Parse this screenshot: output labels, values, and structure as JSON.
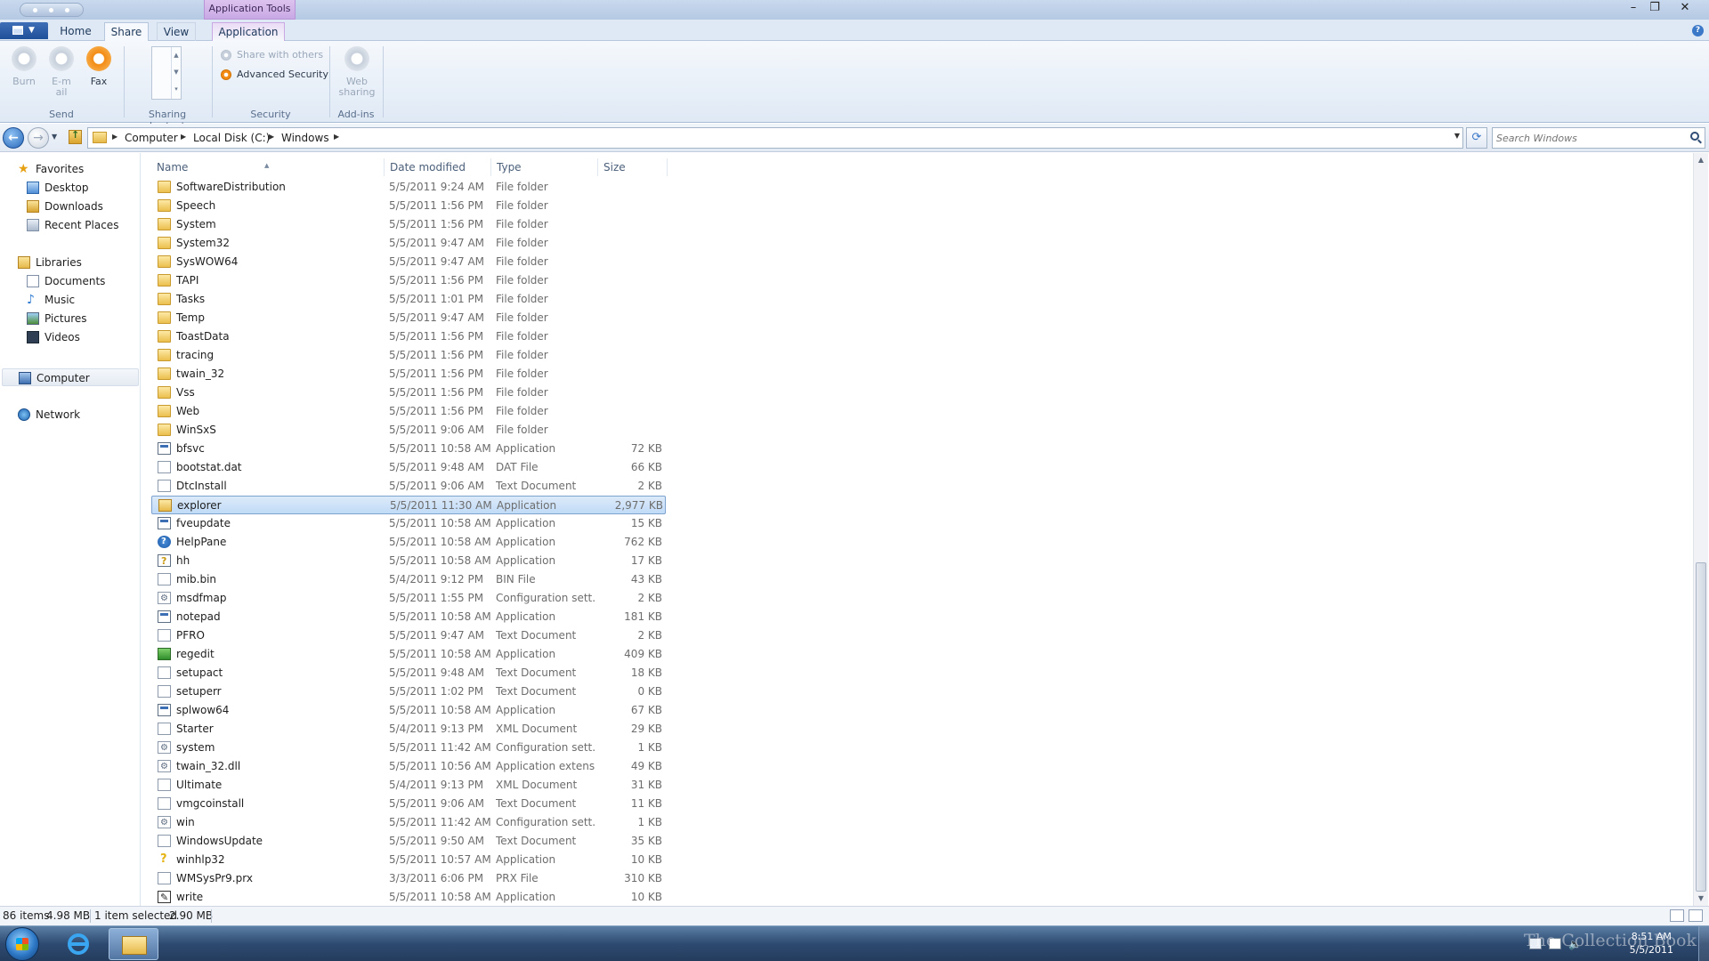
{
  "window": {
    "context_tab_group": "Application Tools",
    "controls": {
      "minimize": "–",
      "maximize": "❐",
      "close": "✕"
    }
  },
  "ribbon": {
    "tabs": [
      {
        "label": "Home",
        "active": false
      },
      {
        "label": "Share",
        "active": true
      },
      {
        "label": "View",
        "active": false
      },
      {
        "label": "Application",
        "context": true
      }
    ],
    "help": "?",
    "groups": {
      "send": {
        "label": "Send",
        "buttons": [
          {
            "label": "Burn",
            "enabled": false
          },
          {
            "label": "E-mail",
            "enabled": false
          },
          {
            "label": "Fax",
            "enabled": true
          }
        ]
      },
      "sharing_shortcuts": {
        "label": "Sharing shortcuts"
      },
      "security": {
        "label": "Security",
        "options": [
          {
            "label": "Share with others",
            "enabled": false
          },
          {
            "label": "Advanced Security",
            "enabled": true
          }
        ]
      },
      "addins": {
        "label": "Add-ins",
        "web_sharing": "Web sharing"
      }
    }
  },
  "address_bar": {
    "breadcrumbs": [
      "Computer",
      "Local Disk (C:)",
      "Windows"
    ],
    "search_placeholder": "Search Windows"
  },
  "nav_pane": {
    "favorites": {
      "label": "Favorites",
      "items": [
        "Desktop",
        "Downloads",
        "Recent Places"
      ]
    },
    "libraries": {
      "label": "Libraries",
      "items": [
        "Documents",
        "Music",
        "Pictures",
        "Videos"
      ]
    },
    "computer": "Computer",
    "network": "Network"
  },
  "columns": {
    "name": "Name",
    "date": "Date modified",
    "type": "Type",
    "size": "Size"
  },
  "files": [
    {
      "name": "SoftwareDistribution",
      "date": "5/5/2011 9:24 AM",
      "type": "File folder",
      "size": "",
      "icon": "folder"
    },
    {
      "name": "Speech",
      "date": "5/5/2011 1:56 PM",
      "type": "File folder",
      "size": "",
      "icon": "folder"
    },
    {
      "name": "System",
      "date": "5/5/2011 1:56 PM",
      "type": "File folder",
      "size": "",
      "icon": "folder"
    },
    {
      "name": "System32",
      "date": "5/5/2011 9:47 AM",
      "type": "File folder",
      "size": "",
      "icon": "folder"
    },
    {
      "name": "SysWOW64",
      "date": "5/5/2011 9:47 AM",
      "type": "File folder",
      "size": "",
      "icon": "folder"
    },
    {
      "name": "TAPI",
      "date": "5/5/2011 1:56 PM",
      "type": "File folder",
      "size": "",
      "icon": "folder"
    },
    {
      "name": "Tasks",
      "date": "5/5/2011 1:01 PM",
      "type": "File folder",
      "size": "",
      "icon": "folder"
    },
    {
      "name": "Temp",
      "date": "5/5/2011 9:47 AM",
      "type": "File folder",
      "size": "",
      "icon": "folder"
    },
    {
      "name": "ToastData",
      "date": "5/5/2011 1:56 PM",
      "type": "File folder",
      "size": "",
      "icon": "folder"
    },
    {
      "name": "tracing",
      "date": "5/5/2011 1:56 PM",
      "type": "File folder",
      "size": "",
      "icon": "folder"
    },
    {
      "name": "twain_32",
      "date": "5/5/2011 1:56 PM",
      "type": "File folder",
      "size": "",
      "icon": "folder"
    },
    {
      "name": "Vss",
      "date": "5/5/2011 1:56 PM",
      "type": "File folder",
      "size": "",
      "icon": "folder"
    },
    {
      "name": "Web",
      "date": "5/5/2011 1:56 PM",
      "type": "File folder",
      "size": "",
      "icon": "folder"
    },
    {
      "name": "WinSxS",
      "date": "5/5/2011 9:06 AM",
      "type": "File folder",
      "size": "",
      "icon": "folder"
    },
    {
      "name": "bfsvc",
      "date": "5/5/2011 10:58 AM",
      "type": "Application",
      "size": "72 KB",
      "icon": "app"
    },
    {
      "name": "bootstat.dat",
      "date": "5/5/2011 9:48 AM",
      "type": "DAT File",
      "size": "66 KB",
      "icon": "doc"
    },
    {
      "name": "DtcInstall",
      "date": "5/5/2011 9:06 AM",
      "type": "Text Document",
      "size": "2 KB",
      "icon": "doc"
    },
    {
      "name": "explorer",
      "date": "5/5/2011 11:30 AM",
      "type": "Application",
      "size": "2,977 KB",
      "icon": "explorer",
      "selected": true
    },
    {
      "name": "fveupdate",
      "date": "5/5/2011 10:58 AM",
      "type": "Application",
      "size": "15 KB",
      "icon": "app"
    },
    {
      "name": "HelpPane",
      "date": "5/5/2011 10:58 AM",
      "type": "Application",
      "size": "762 KB",
      "icon": "help"
    },
    {
      "name": "hh",
      "date": "5/5/2011 10:58 AM",
      "type": "Application",
      "size": "17 KB",
      "icon": "hh"
    },
    {
      "name": "mib.bin",
      "date": "5/4/2011 9:12 PM",
      "type": "BIN File",
      "size": "43 KB",
      "icon": "doc"
    },
    {
      "name": "msdfmap",
      "date": "5/5/2011 1:55 PM",
      "type": "Configuration sett...",
      "size": "2 KB",
      "icon": "cfg"
    },
    {
      "name": "notepad",
      "date": "5/5/2011 10:58 AM",
      "type": "Application",
      "size": "181 KB",
      "icon": "app"
    },
    {
      "name": "PFRO",
      "date": "5/5/2011 9:47 AM",
      "type": "Text Document",
      "size": "2 KB",
      "icon": "doc"
    },
    {
      "name": "regedit",
      "date": "5/5/2011 10:58 AM",
      "type": "Application",
      "size": "409 KB",
      "icon": "regedit"
    },
    {
      "name": "setupact",
      "date": "5/5/2011 9:48 AM",
      "type": "Text Document",
      "size": "18 KB",
      "icon": "doc"
    },
    {
      "name": "setuperr",
      "date": "5/5/2011 1:02 PM",
      "type": "Text Document",
      "size": "0 KB",
      "icon": "doc"
    },
    {
      "name": "splwow64",
      "date": "5/5/2011 10:58 AM",
      "type": "Application",
      "size": "67 KB",
      "icon": "app"
    },
    {
      "name": "Starter",
      "date": "5/4/2011 9:13 PM",
      "type": "XML Document",
      "size": "29 KB",
      "icon": "doc"
    },
    {
      "name": "system",
      "date": "5/5/2011 11:42 AM",
      "type": "Configuration sett...",
      "size": "1 KB",
      "icon": "cfg"
    },
    {
      "name": "twain_32.dll",
      "date": "5/5/2011 10:56 AM",
      "type": "Application extens...",
      "size": "49 KB",
      "icon": "cfg"
    },
    {
      "name": "Ultimate",
      "date": "5/4/2011 9:13 PM",
      "type": "XML Document",
      "size": "31 KB",
      "icon": "doc"
    },
    {
      "name": "vmgcoinstall",
      "date": "5/5/2011 9:06 AM",
      "type": "Text Document",
      "size": "11 KB",
      "icon": "doc"
    },
    {
      "name": "win",
      "date": "5/5/2011 11:42 AM",
      "type": "Configuration sett...",
      "size": "1 KB",
      "icon": "cfg"
    },
    {
      "name": "WindowsUpdate",
      "date": "5/5/2011 9:50 AM",
      "type": "Text Document",
      "size": "35 KB",
      "icon": "doc"
    },
    {
      "name": "winhlp32",
      "date": "5/5/2011 10:57 AM",
      "type": "Application",
      "size": "10 KB",
      "icon": "winhlp"
    },
    {
      "name": "WMSysPr9.prx",
      "date": "3/3/2011 6:06 PM",
      "type": "PRX File",
      "size": "310 KB",
      "icon": "doc"
    },
    {
      "name": "write",
      "date": "5/5/2011 10:58 AM",
      "type": "Application",
      "size": "10 KB",
      "icon": "write"
    }
  ],
  "status": {
    "items_count": "86 items",
    "total_size": "4.98 MB",
    "selection": "1 item selected",
    "selection_size": "2.90 MB"
  },
  "taskbar": {
    "time": "8:51 AM",
    "date": "5/5/2011",
    "watermark": "The Collection Book"
  }
}
